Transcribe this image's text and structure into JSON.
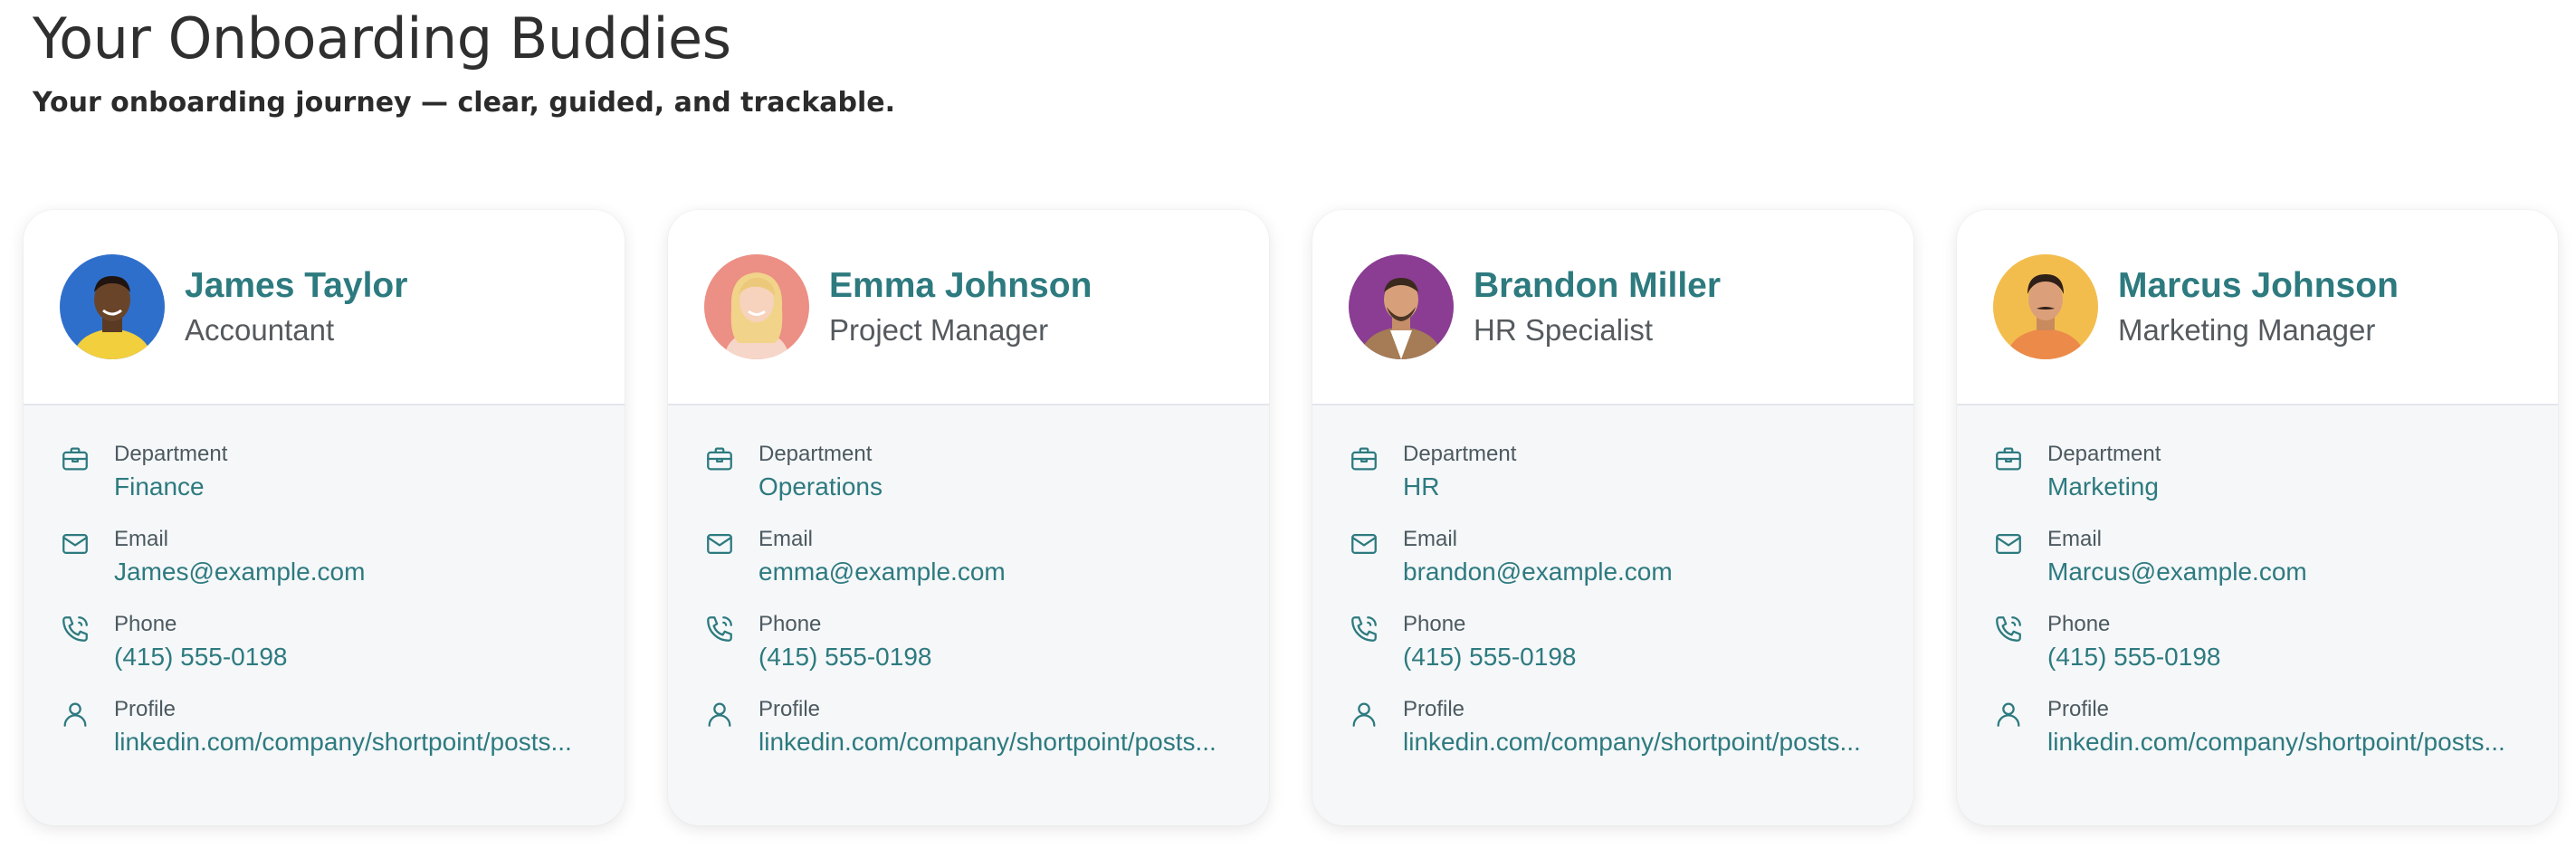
{
  "header": {
    "title": "Your Onboarding Buddies",
    "subtitle": "Your onboarding journey — clear, guided, and trackable."
  },
  "labels": {
    "department": "Department",
    "email": "Email",
    "phone": "Phone",
    "profile": "Profile"
  },
  "colors": {
    "accent": "#2d7a7f",
    "card_body": "#f5f7f9"
  },
  "icons": {
    "department": "briefcase-icon",
    "email": "mail-icon",
    "phone": "phone-icon",
    "profile": "user-icon"
  },
  "buddies": [
    {
      "name": "James Taylor",
      "role": "Accountant",
      "department": "Finance",
      "email": "James@example.com",
      "phone": "(415) 555-0198",
      "profile": "linkedin.com/company/shortpoint/posts...",
      "avatar_bg": "#2f6fcc"
    },
    {
      "name": "Emma Johnson",
      "role": "Project Manager",
      "department": "Operations",
      "email": "emma@example.com",
      "phone": "(415) 555-0198",
      "profile": "linkedin.com/company/shortpoint/posts...",
      "avatar_bg": "#ec8f84"
    },
    {
      "name": "Brandon Miller",
      "role": "HR Specialist",
      "department": "HR",
      "email": "brandon@example.com",
      "phone": "(415) 555-0198",
      "profile": "linkedin.com/company/shortpoint/posts...",
      "avatar_bg": "#8a3d92"
    },
    {
      "name": "Marcus Johnson",
      "role": "Marketing Manager",
      "department": "Marketing",
      "email": "Marcus@example.com",
      "phone": "(415) 555-0198",
      "profile": "linkedin.com/company/shortpoint/posts...",
      "avatar_bg": "#f3bd4e"
    }
  ]
}
